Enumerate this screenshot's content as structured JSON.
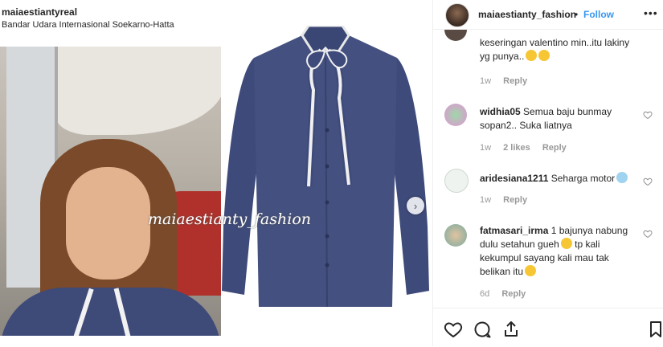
{
  "post": {
    "image_username": "maiaestiantyreal",
    "image_location": "Bandar Udara Internasional Soekarno-Hatta",
    "watermark": "maiaestianty_fashion"
  },
  "header": {
    "username": "maiaestianty_fashion",
    "dot": "•",
    "follow": "Follow",
    "more": "•••"
  },
  "comments": [
    {
      "username": "",
      "text": "keseringan valentino min..itu lakiny yg punya..",
      "age": "1w",
      "likes": "",
      "reply": "Reply"
    },
    {
      "username": "widhia05",
      "text": "Semua baju bunmay sopan2.. Suka liatnya",
      "age": "1w",
      "likes": "2 likes",
      "reply": "Reply"
    },
    {
      "username": "aridesiana1211",
      "text": "Seharga motor",
      "age": "1w",
      "likes": "",
      "reply": "Reply"
    },
    {
      "username": "fatmasari_irma",
      "text": "1 bajunya nabung dulu setahun gueh",
      "text2": "tp kali kekumpul sayang kali mau tak belikan itu",
      "age": "6d",
      "likes": "",
      "reply": "Reply"
    }
  ],
  "icons": {
    "like": "heart-icon",
    "comment": "comment-icon",
    "share": "share-icon",
    "save": "bookmark-icon"
  },
  "colors": {
    "follow": "#3897f0",
    "text": "#262626",
    "muted": "#999999",
    "blouse": "#3e4a7a"
  }
}
